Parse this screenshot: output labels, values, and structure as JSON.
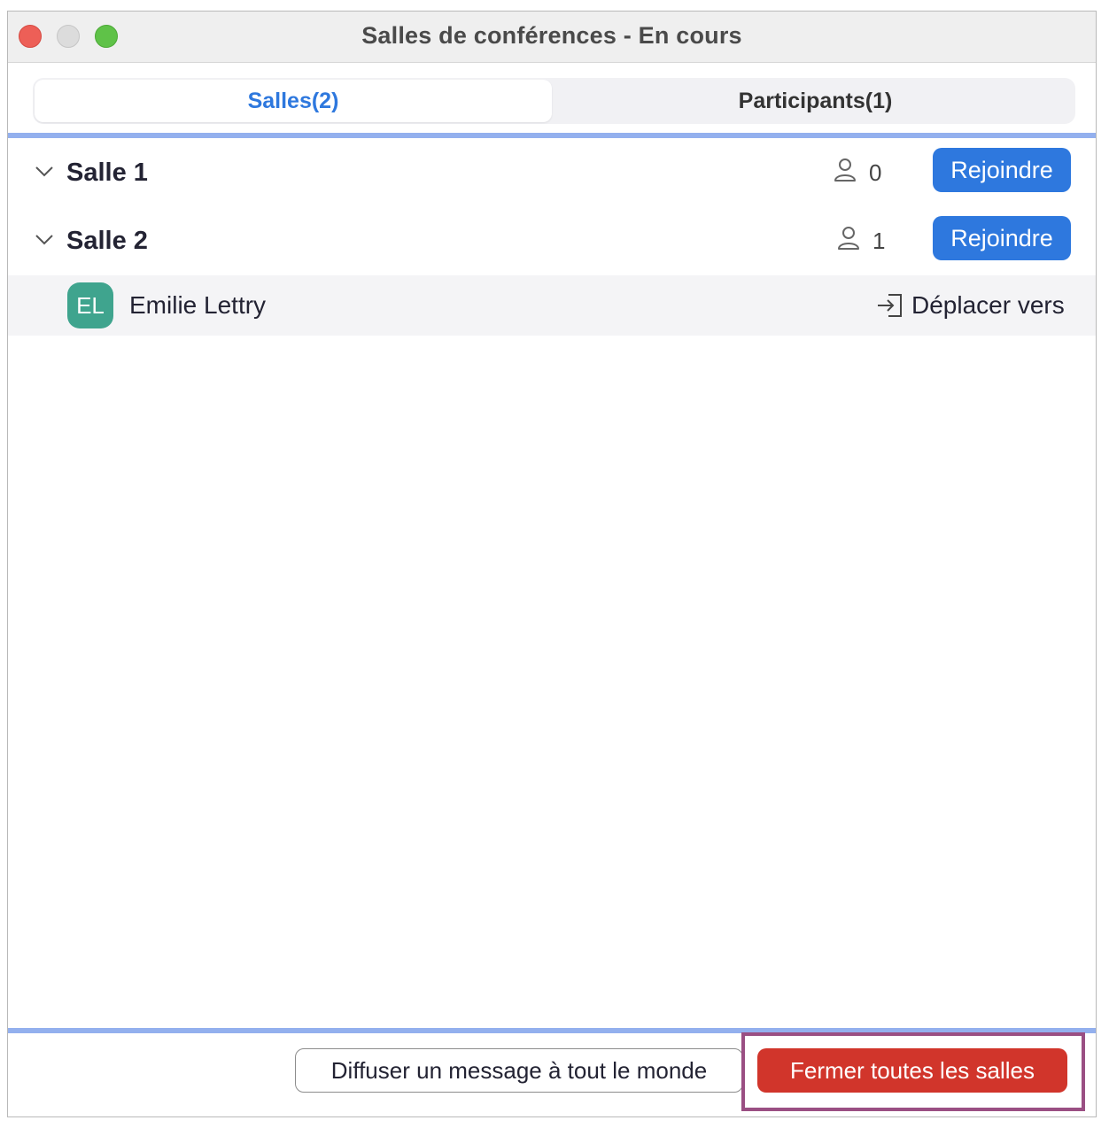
{
  "window": {
    "title": "Salles de conférences - En cours"
  },
  "tabs": [
    {
      "label": "Salles(2)",
      "active": true
    },
    {
      "label": "Participants(1)",
      "active": false
    }
  ],
  "rooms": [
    {
      "name": "Salle 1",
      "count": "0",
      "join_label": "Rejoindre",
      "expanded": true
    },
    {
      "name": "Salle 2",
      "count": "1",
      "join_label": "Rejoindre",
      "expanded": true
    }
  ],
  "participants": [
    {
      "initials": "EL",
      "name": "Emilie Lettry",
      "action_label": "Déplacer vers",
      "room": "Salle 2",
      "avatar_color": "#3fa48e"
    }
  ],
  "footer": {
    "broadcast_label": "Diffuser un message à tout le monde",
    "close_all_label": "Fermer toutes les salles"
  },
  "colors": {
    "accent": "#2e78de",
    "danger": "#d1352b",
    "divider": "#93b0ee",
    "highlight": "#9a4f83"
  },
  "icons": {
    "chevron": "chevron-down-icon",
    "people": "person-icon",
    "move": "move-to-icon"
  }
}
